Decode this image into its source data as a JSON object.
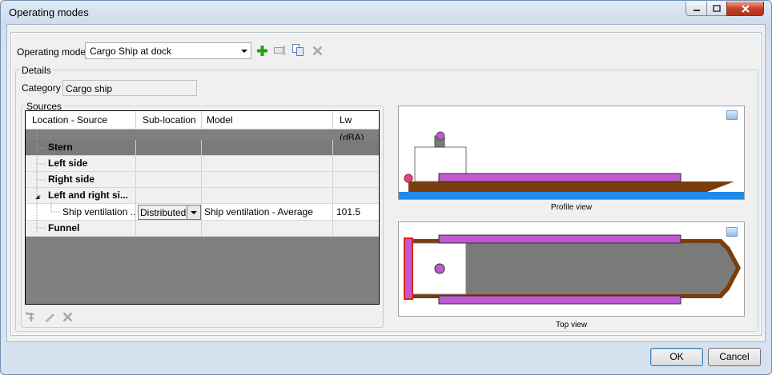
{
  "window": {
    "title": "Operating modes"
  },
  "operating_mode": {
    "label": "Operating mode",
    "value": "Cargo Ship at dock"
  },
  "details": {
    "group_title": "Details",
    "category_label": "Category",
    "category_value": "Cargo ship"
  },
  "sources": {
    "group_title": "Sources",
    "columns": [
      "Location - Source",
      "Sub-location",
      "Model",
      "Lw (dBA)"
    ],
    "rows": [
      {
        "location": "Stern",
        "sub": "",
        "model": "",
        "lw": ""
      },
      {
        "location": "Left side",
        "sub": "",
        "model": "",
        "lw": ""
      },
      {
        "location": "Right side",
        "sub": "",
        "model": "",
        "lw": ""
      },
      {
        "location": "Left and right si...",
        "sub": "",
        "model": "",
        "lw": ""
      },
      {
        "location": "Ship ventilation ...",
        "sub": "Distributed",
        "model": "Ship ventilation - Average",
        "lw": "101.5"
      },
      {
        "location": "Funnel",
        "sub": "",
        "model": "",
        "lw": ""
      }
    ],
    "expander_glyph": "◢"
  },
  "views": {
    "profile_caption": "Profile view",
    "top_caption": "Top view"
  },
  "buttons": {
    "ok": "OK",
    "cancel": "Cancel"
  },
  "icons": {
    "add": "plus-icon",
    "edit": "rename-icon",
    "copy": "copy-icon",
    "delete": "delete-icon",
    "add_source": "add-source-icon",
    "edit_source": "pencil-icon",
    "delete_source": "delete-icon",
    "image": "image-icon"
  },
  "colors": {
    "hull": "#7a3d0c",
    "deck_equipment": "#c059d2",
    "water": "#1e8ce8",
    "selected_row": "#7a7a7a",
    "grid_background": "#808080",
    "add_green": "#22a012",
    "stern_marker": "#e0201a",
    "funnel_grey": "#7a7a7a"
  }
}
